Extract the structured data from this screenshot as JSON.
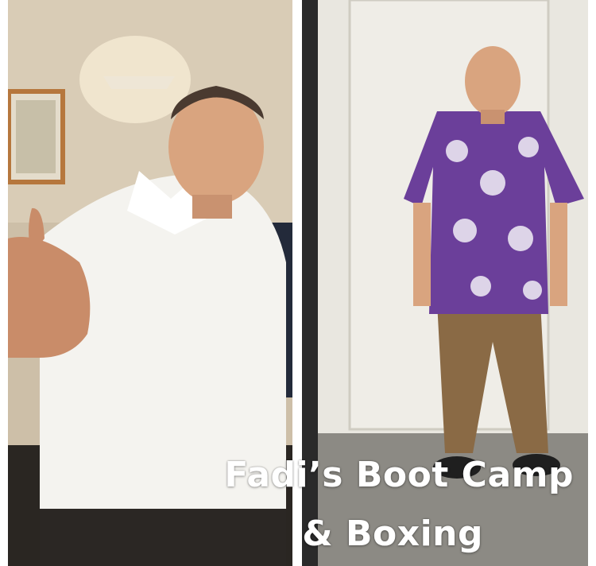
{
  "caption": {
    "line1": "Fadi’s Boot Camp",
    "line2": "& Boxing"
  },
  "colors": {
    "divider": "#ffffff",
    "shirt_white": "#f4f3ef",
    "shirt_purple": "#6b3f9a",
    "pants_brown": "#8a6a45",
    "caption_text": "#ffffff"
  }
}
